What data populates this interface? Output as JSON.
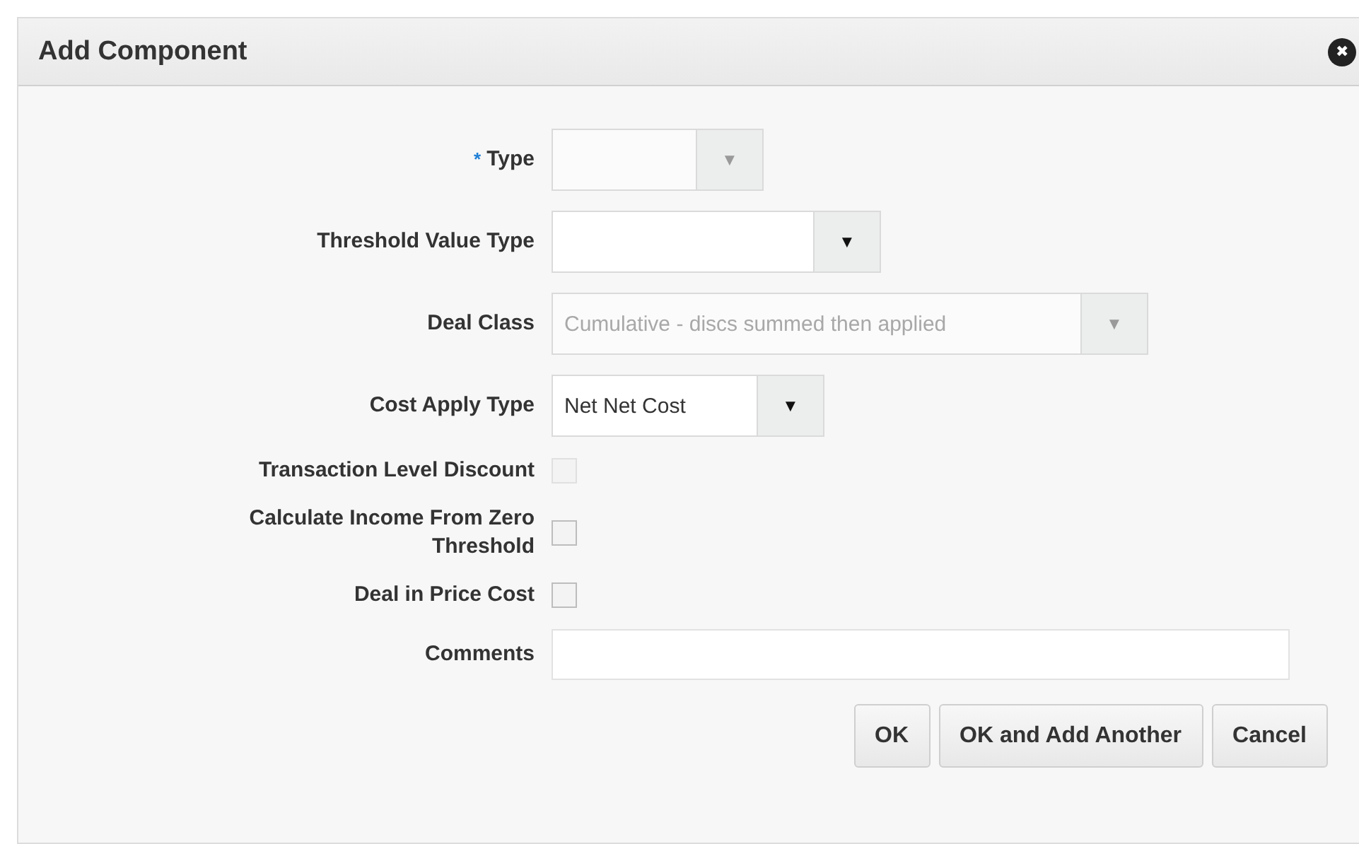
{
  "dialog": {
    "title": "Add Component",
    "close": "✖"
  },
  "fields": [
    {
      "kind": "select",
      "label": "Type",
      "required_mark": "*",
      "disabled": true,
      "caret": "▼"
    },
    {
      "kind": "select",
      "label": "Threshold Value Type",
      "disabled": false,
      "caret": "▼"
    },
    {
      "kind": "select",
      "label": "Deal Class",
      "value": "Cumulative - discs summed then applied",
      "disabled": true,
      "caret": "▼"
    },
    {
      "kind": "select",
      "label": "Cost Apply Type",
      "value": "Net Net Cost",
      "disabled": false,
      "caret": "▼"
    },
    {
      "kind": "checkbox",
      "label": "Transaction Level Discount",
      "checked": false,
      "disabled": true
    },
    {
      "kind": "checkbox",
      "label": "Calculate Income From Zero Threshold",
      "checked": false,
      "disabled": false
    },
    {
      "kind": "checkbox",
      "label": "Deal in Price Cost",
      "checked": false,
      "disabled": false
    },
    {
      "kind": "textarea",
      "label": "Comments"
    }
  ],
  "buttons": [
    "OK",
    "OK and Add Another",
    "Cancel"
  ]
}
